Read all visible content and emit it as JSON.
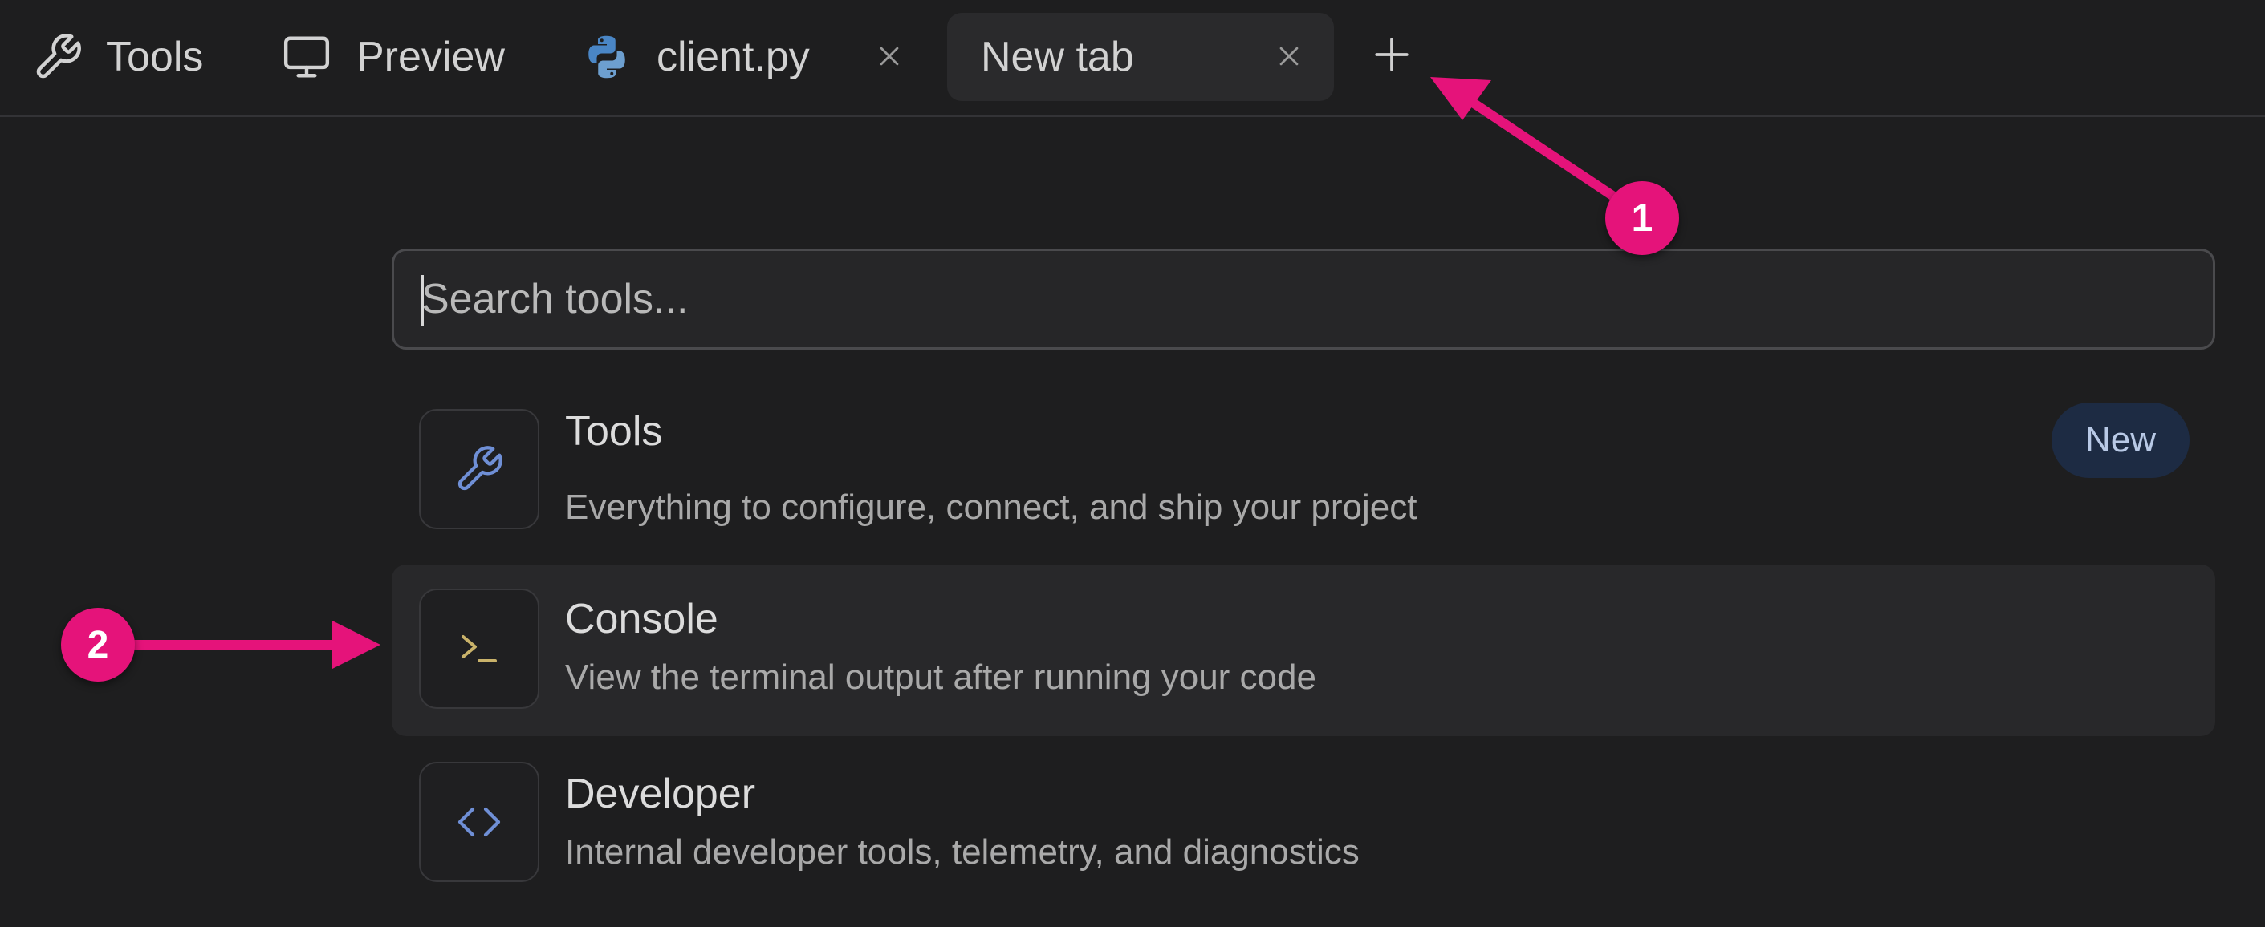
{
  "tabs": {
    "tools": {
      "label": "Tools",
      "icon": "wrench-icon"
    },
    "preview": {
      "label": "Preview",
      "icon": "monitor-icon"
    },
    "client": {
      "label": "client.py",
      "icon": "python-icon",
      "closable": true
    },
    "new_tab": {
      "label": "New tab",
      "active": true,
      "closable": true
    },
    "add_tab_icon": "plus-icon"
  },
  "search": {
    "placeholder": "Search tools..."
  },
  "items": [
    {
      "title": "Tools",
      "description": "Everything to configure, connect, and ship your project",
      "icon": "wrench-icon",
      "badge": "New",
      "highlighted": false
    },
    {
      "title": "Console",
      "description": "View the terminal output after running your code",
      "icon": "terminal-icon",
      "highlighted": true
    },
    {
      "title": "Developer",
      "description": "Internal developer tools, telemetry, and diagnostics",
      "icon": "code-icon",
      "highlighted": false
    }
  ],
  "annotations": {
    "marker_1": "1",
    "marker_2": "2",
    "color": "#e5137a"
  },
  "colors": {
    "background": "#1e1e1f",
    "active_tab": "#2a2a2c",
    "badge_background": "#1d2b43",
    "icon_blue": "#6f8fd6",
    "terminal_icon": "#c9b26a"
  }
}
